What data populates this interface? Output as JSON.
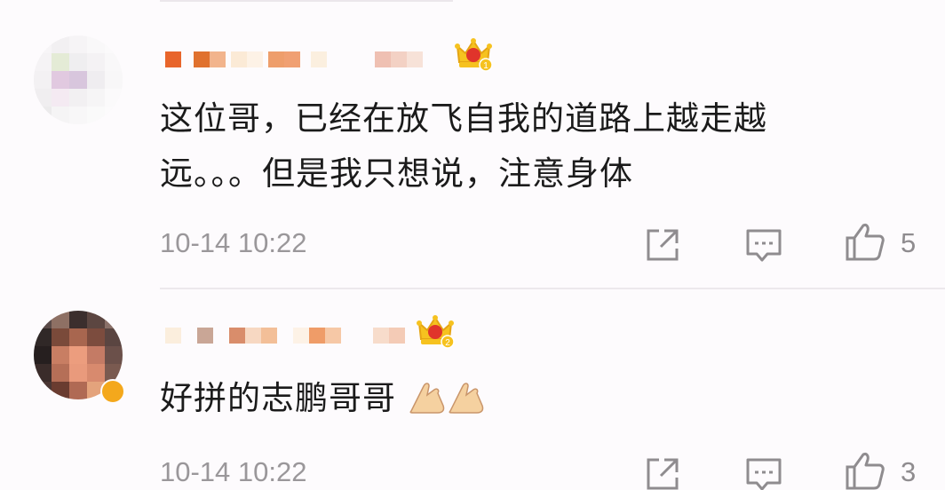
{
  "comments": [
    {
      "text": "这位哥，已经在放飞自我的道路上越走越远。。。但是我只想说，注意身体",
      "text_line1": "这位哥，已经在放飞自我的道路上越走越",
      "text_line2": "远。。。但是我只想说，注意身体",
      "timestamp": "10-14 10:22",
      "like_count": "5",
      "crown_level": "1",
      "username": "",
      "share_icon": "share-icon",
      "comment_icon": "comment-icon",
      "like_icon": "thumbs-up-icon"
    },
    {
      "text": "好拼的志鹏哥哥",
      "emoji": [
        "folded-hands-emoji",
        "folded-hands-emoji"
      ],
      "timestamp": "10-14 10:22",
      "like_count": "3",
      "crown_level": "2",
      "username": "",
      "share_icon": "share-icon",
      "comment_icon": "comment-icon",
      "like_icon": "thumbs-up-icon"
    }
  ],
  "colors": {
    "background": "#fdfbfd",
    "text": "#1b1b1b",
    "meta": "#9a979a",
    "crown_gold": "#f6c21f",
    "crown_red": "#e0342b",
    "vip_badge": "#f4a81c",
    "divider": "#ece8ec"
  }
}
